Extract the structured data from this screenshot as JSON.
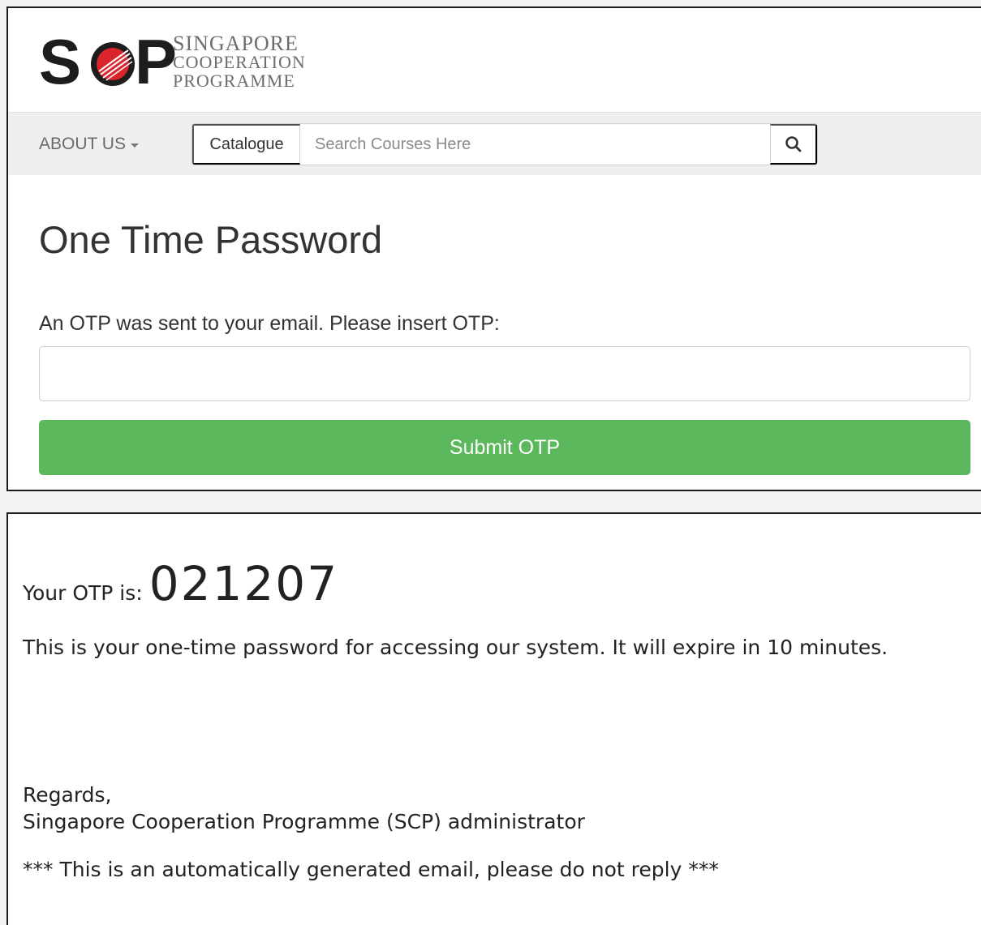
{
  "site": {
    "logo": {
      "letters": [
        "S",
        "P"
      ],
      "line1": "SINGAPORE",
      "line2": "COOPERATION",
      "line3": "PROGRAMME"
    },
    "nav": {
      "about_label": "ABOUT US",
      "catalogue_label": "Catalogue",
      "search_placeholder": "Search Courses Here"
    },
    "form": {
      "title": "One Time Password",
      "label": "An OTP was sent to your email. Please insert OTP:",
      "otp_value": "",
      "submit_label": "Submit OTP"
    },
    "colors": {
      "submit": "#5cb85c",
      "logo_red": "#d9252b"
    }
  },
  "email": {
    "prefix": "Your OTP is:",
    "code": "021207",
    "description": "This is your one-time password for accessing our system. It will expire in 10 minutes.",
    "regards": "Regards,",
    "signature": "Singapore Cooperation Programme (SCP) administrator",
    "auto_note": "*** This is an automatically generated email, please do not reply ***"
  }
}
